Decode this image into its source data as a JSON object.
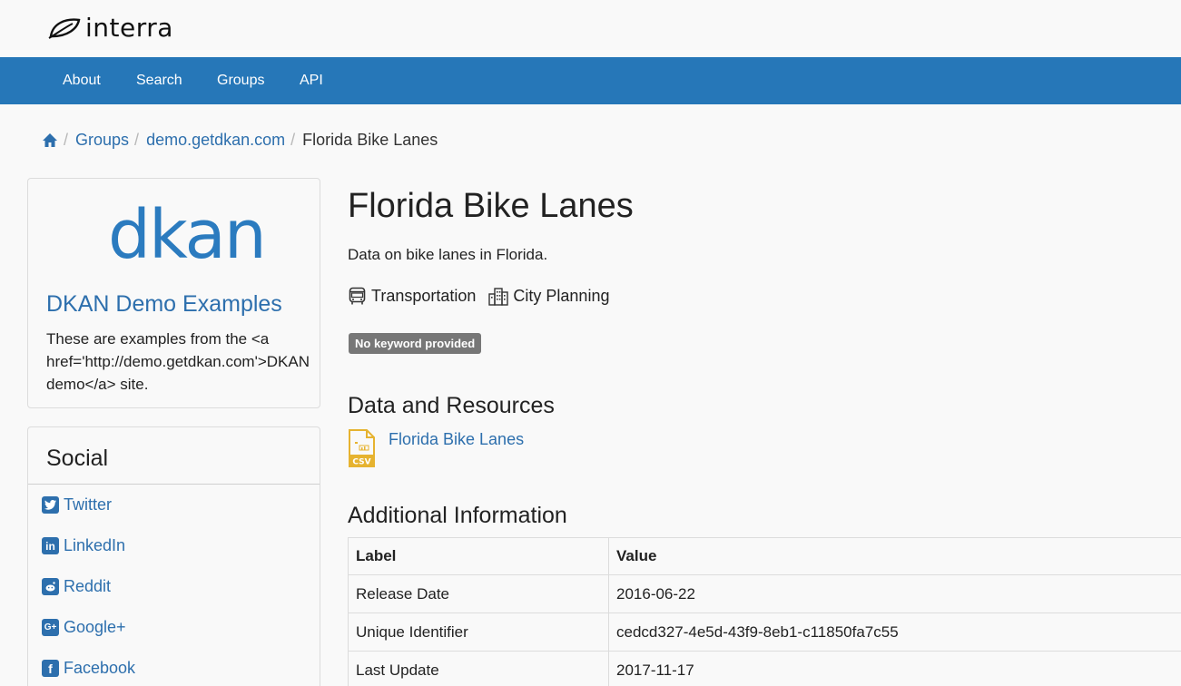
{
  "brand": {
    "name": "interra"
  },
  "nav": {
    "items": [
      "About",
      "Search",
      "Groups",
      "API"
    ]
  },
  "breadcrumb": {
    "items": [
      "Groups",
      "demo.getdkan.com"
    ],
    "current": "Florida Bike Lanes"
  },
  "org": {
    "logo_text": "dkan",
    "title": "DKAN Demo Examples",
    "description": "These are examples from the <a href='http://demo.getdkan.com'>DKAN demo</a> site."
  },
  "social": {
    "title": "Social",
    "items": [
      {
        "label": "Twitter",
        "icon": "twitter-icon"
      },
      {
        "label": "LinkedIn",
        "icon": "linkedin-icon"
      },
      {
        "label": "Reddit",
        "icon": "reddit-icon"
      },
      {
        "label": "Google+",
        "icon": "google-plus-icon"
      },
      {
        "label": "Facebook",
        "icon": "facebook-icon"
      }
    ]
  },
  "dataset": {
    "title": "Florida Bike Lanes",
    "description": "Data on bike lanes in Florida.",
    "topics": [
      {
        "label": "Transportation",
        "icon": "bus-icon"
      },
      {
        "label": "City Planning",
        "icon": "city-icon"
      }
    ],
    "keyword_badge": "No keyword provided"
  },
  "resources": {
    "title": "Data and Resources",
    "items": [
      {
        "label": "Florida Bike Lanes",
        "format": "CSV"
      }
    ]
  },
  "additional": {
    "title": "Additional Information",
    "headers": [
      "Label",
      "Value"
    ],
    "rows": [
      [
        "Release Date",
        "2016-06-22"
      ],
      [
        "Unique Identifier",
        "cedcd327-4e5d-43f9-8eb1-c11850fa7c55"
      ],
      [
        "Last Update",
        "2017-11-17"
      ]
    ]
  },
  "colors": {
    "navbar": "#2677b8",
    "link": "#2d6fad",
    "badge": "#777777",
    "csv_icon": "#e6b330"
  }
}
